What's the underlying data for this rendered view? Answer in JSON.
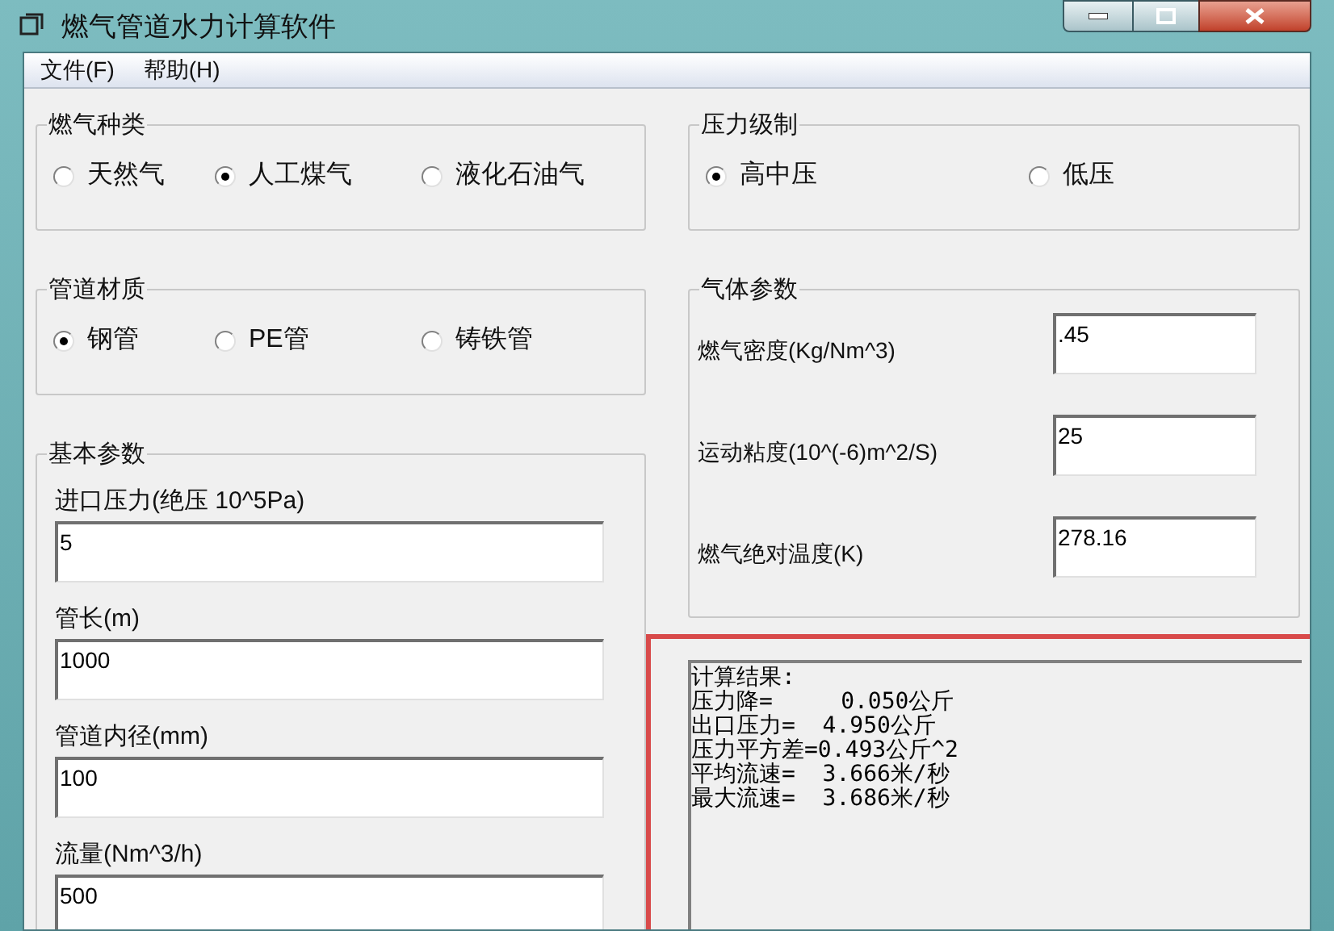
{
  "window": {
    "title": "燃气管道水力计算软件"
  },
  "menu": [
    {
      "label": "文件(F)"
    },
    {
      "label": "帮助(H)"
    }
  ],
  "gas_type": {
    "title": "燃气种类",
    "options": [
      {
        "label": "天然气",
        "selected": false
      },
      {
        "label": "人工煤气",
        "selected": true
      },
      {
        "label": "液化石油气",
        "selected": false
      }
    ]
  },
  "pressure_class": {
    "title": "压力级制",
    "options": [
      {
        "label": "高中压",
        "selected": true
      },
      {
        "label": "低压",
        "selected": false
      }
    ]
  },
  "pipe_material": {
    "title": "管道材质",
    "options": [
      {
        "label": "钢管",
        "selected": true
      },
      {
        "label": "PE管",
        "selected": false
      },
      {
        "label": "铸铁管",
        "selected": false
      }
    ]
  },
  "gas_params": {
    "title": "气体参数",
    "fields": [
      {
        "label": "燃气密度(Kg/Nm^3)",
        "value": ".45"
      },
      {
        "label": "运动粘度(10^(-6)m^2/S)",
        "value": "25"
      },
      {
        "label": "燃气绝对温度(K)",
        "value": "278.16"
      }
    ]
  },
  "basic_params": {
    "title": "基本参数",
    "fields": [
      {
        "label": "进口压力(绝压 10^5Pa)",
        "value": "5"
      },
      {
        "label": "管长(m)",
        "value": "1000"
      },
      {
        "label": "管道内径(mm)",
        "value": "100"
      },
      {
        "label": "流量(Nm^3/h)",
        "value": "500"
      }
    ]
  },
  "result": {
    "lines": [
      "计算结果:",
      "压力降=     0.050公斤",
      "出口压力=  4.950公斤",
      "压力平方差=0.493公斤^2",
      "平均流速=  3.666米/秒",
      "最大流速=  3.686米/秒"
    ]
  }
}
